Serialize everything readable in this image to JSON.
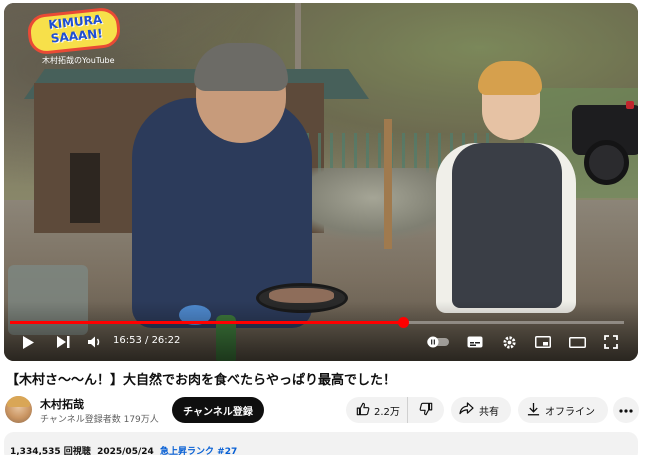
{
  "video": {
    "logo_text": "KIMURA SAAAN!",
    "logo_sub": "木村拓哉のYouTube",
    "time_current": "16:53",
    "time_total": "26:22",
    "time_separator": " / ",
    "progress_fraction": 0.64
  },
  "title": "【木村さ〜〜ん！】大自然でお肉を食べたらやっぱり最高でした！",
  "channel": {
    "name": "木村拓哉",
    "subscribers": "チャンネル登録者数 179万人",
    "subscribe_label": "チャンネル登録"
  },
  "actions": {
    "like_count": "2.2万",
    "share_label": "共有",
    "offline_label": "オフライン"
  },
  "description": {
    "views": "1,334,535 回視聴",
    "date": "2025/05/24",
    "trending": "急上昇ランク #27"
  },
  "colors": {
    "progress": "#ff0000",
    "subscribe_bg": "#0f0f0f",
    "pill_bg": "#f2f2f2",
    "hashtag": "#065fd4"
  },
  "icons": [
    "play-icon",
    "next-icon",
    "volume-icon",
    "pause-toggle-icon",
    "subtitles-icon",
    "settings-icon",
    "miniplayer-icon",
    "theater-icon",
    "fullscreen-icon",
    "thumbs-up-icon",
    "thumbs-down-icon",
    "share-icon",
    "download-icon",
    "more-icon"
  ]
}
